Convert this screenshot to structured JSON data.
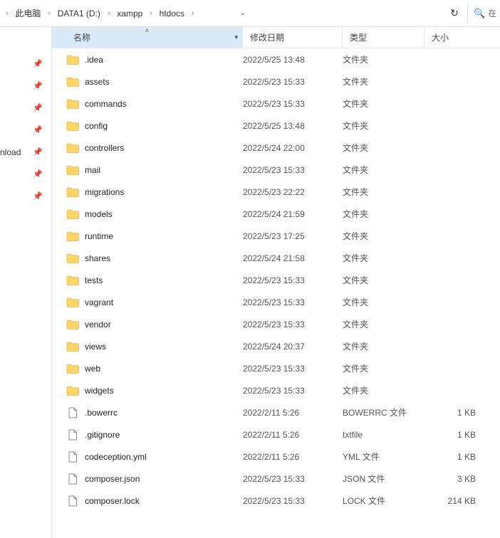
{
  "breadcrumbs": [
    "此电脑",
    "DATA1 (D:)",
    "xampp",
    "htdocs"
  ],
  "search": {
    "placeholder": "在"
  },
  "sidebar": {
    "label": "nload"
  },
  "columns": {
    "name": "名称",
    "date": "修改日期",
    "type": "类型",
    "size": "大小"
  },
  "items": [
    {
      "icon": "folder",
      "name": ".idea",
      "date": "2022/5/25 13:48",
      "type": "文件夹",
      "size": ""
    },
    {
      "icon": "folder",
      "name": "assets",
      "date": "2022/5/23 15:33",
      "type": "文件夹",
      "size": ""
    },
    {
      "icon": "folder",
      "name": "commands",
      "date": "2022/5/23 15:33",
      "type": "文件夹",
      "size": ""
    },
    {
      "icon": "folder",
      "name": "config",
      "date": "2022/5/25 13:48",
      "type": "文件夹",
      "size": ""
    },
    {
      "icon": "folder",
      "name": "controllers",
      "date": "2022/5/24 22:00",
      "type": "文件夹",
      "size": ""
    },
    {
      "icon": "folder",
      "name": "mail",
      "date": "2022/5/23 15:33",
      "type": "文件夹",
      "size": ""
    },
    {
      "icon": "folder",
      "name": "migrations",
      "date": "2022/5/23 22:22",
      "type": "文件夹",
      "size": ""
    },
    {
      "icon": "folder",
      "name": "models",
      "date": "2022/5/24 21:59",
      "type": "文件夹",
      "size": ""
    },
    {
      "icon": "folder",
      "name": "runtime",
      "date": "2022/5/23 17:25",
      "type": "文件夹",
      "size": ""
    },
    {
      "icon": "folder",
      "name": "shares",
      "date": "2022/5/24 21:58",
      "type": "文件夹",
      "size": ""
    },
    {
      "icon": "folder",
      "name": "tests",
      "date": "2022/5/23 15:33",
      "type": "文件夹",
      "size": ""
    },
    {
      "icon": "folder",
      "name": "vagrant",
      "date": "2022/5/23 15:33",
      "type": "文件夹",
      "size": ""
    },
    {
      "icon": "folder",
      "name": "vendor",
      "date": "2022/5/23 15:33",
      "type": "文件夹",
      "size": ""
    },
    {
      "icon": "folder",
      "name": "views",
      "date": "2022/5/24 20:37",
      "type": "文件夹",
      "size": ""
    },
    {
      "icon": "folder",
      "name": "web",
      "date": "2022/5/23 15:33",
      "type": "文件夹",
      "size": ""
    },
    {
      "icon": "folder",
      "name": "widgets",
      "date": "2022/5/23 15:33",
      "type": "文件夹",
      "size": ""
    },
    {
      "icon": "file",
      "name": ".bowerrc",
      "date": "2022/2/11 5:26",
      "type": "BOWERRC 文件",
      "size": "1 KB"
    },
    {
      "icon": "file",
      "name": ".gitignore",
      "date": "2022/2/11 5:26",
      "type": "txtfile",
      "size": "1 KB"
    },
    {
      "icon": "file",
      "name": "codeception.yml",
      "date": "2022/2/11 5:26",
      "type": "YML 文件",
      "size": "1 KB"
    },
    {
      "icon": "file",
      "name": "composer.json",
      "date": "2022/5/23 15:33",
      "type": "JSON 文件",
      "size": "3 KB"
    },
    {
      "icon": "file",
      "name": "composer.lock",
      "date": "2022/5/23 15:33",
      "type": "LOCK 文件",
      "size": "214 KB"
    }
  ]
}
